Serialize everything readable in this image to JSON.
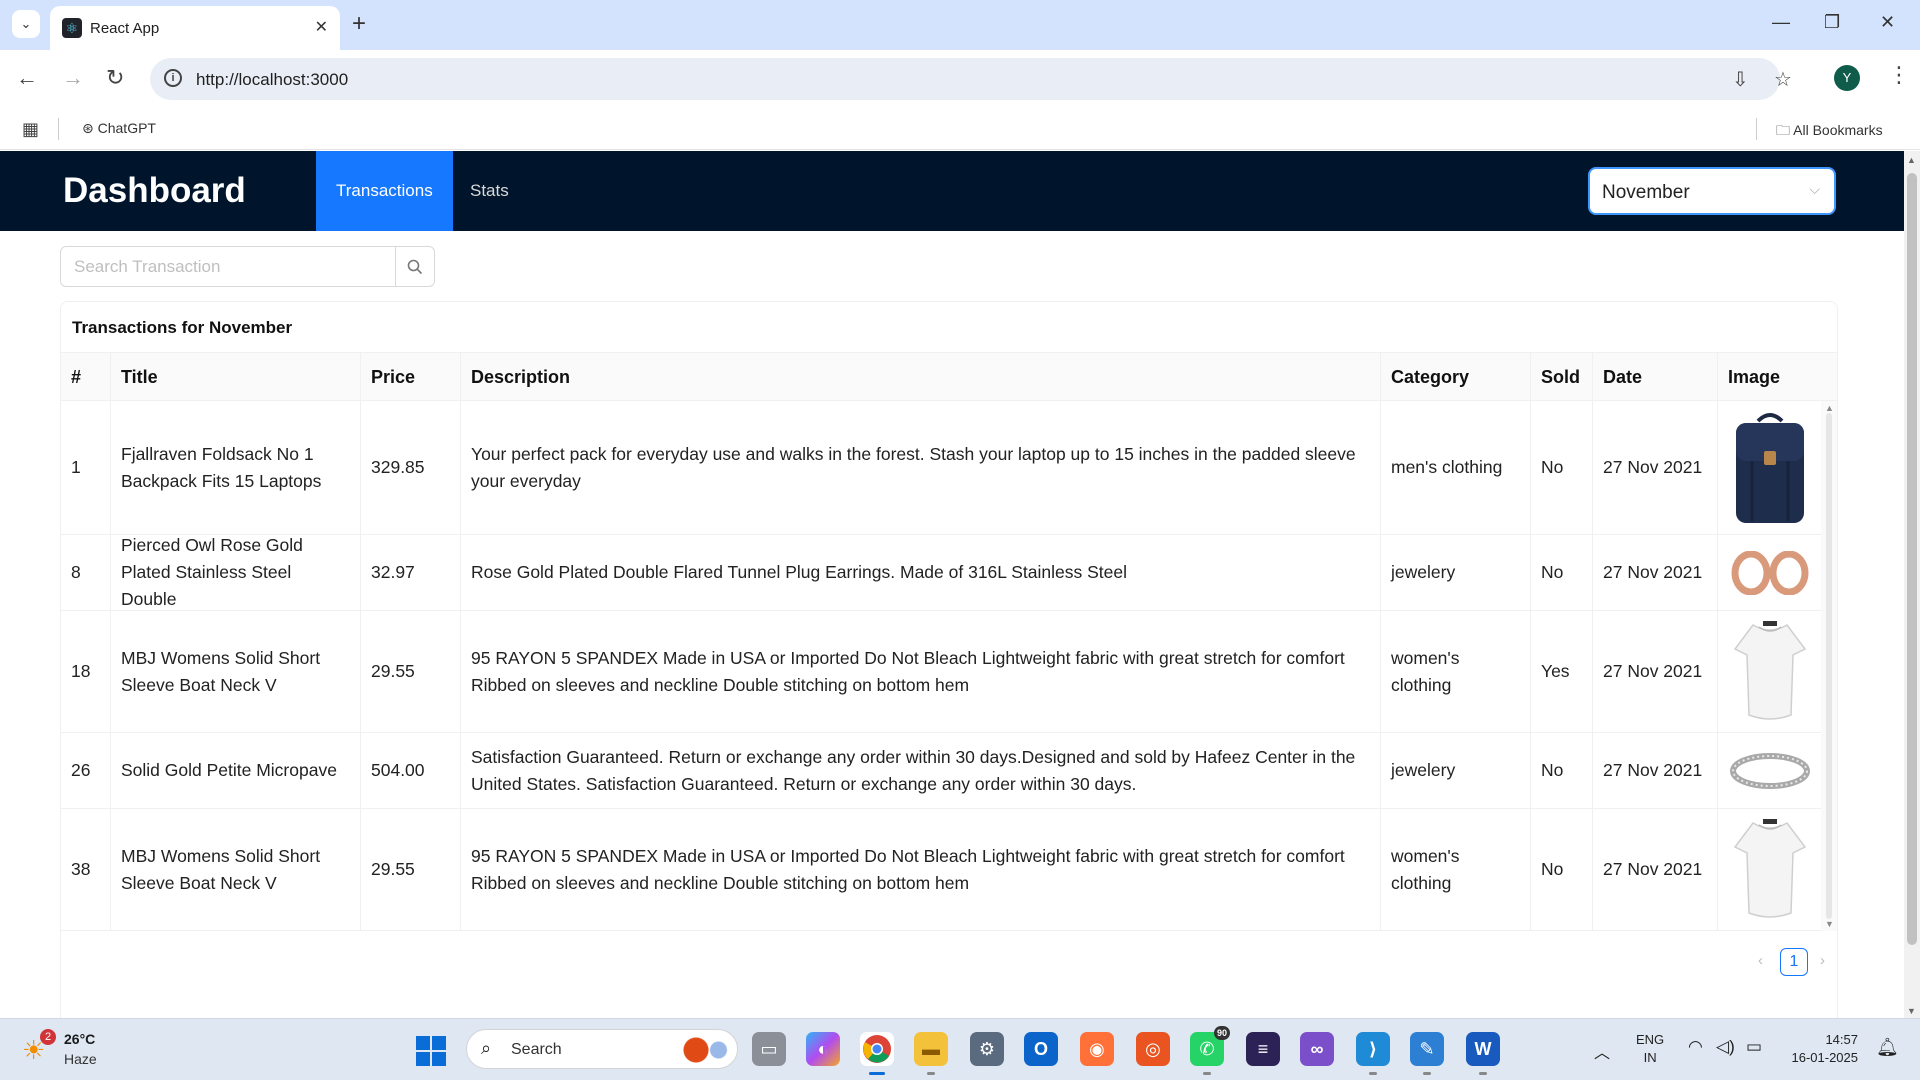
{
  "browser": {
    "tab_title": "React App",
    "url": "http://localhost:3000",
    "profile_initial": "Y",
    "bookmarks": [
      {
        "label": "ChatGPT"
      },
      {
        "label": "All Bookmarks"
      }
    ]
  },
  "app": {
    "brand": "Dashboard",
    "menu": [
      {
        "label": "Transactions",
        "active": true
      },
      {
        "label": "Stats",
        "active": false
      }
    ],
    "month_select": {
      "value": "November"
    },
    "search": {
      "placeholder": "Search Transaction",
      "value": ""
    },
    "table": {
      "title": "Transactions for November",
      "columns": [
        "#",
        "Title",
        "Price",
        "Description",
        "Category",
        "Sold",
        "Date",
        "Image"
      ],
      "rows": [
        {
          "id": "1",
          "title": "Fjallraven Foldsack No 1 Backpack Fits 15 Laptops",
          "price": "329.85",
          "description": "Your perfect pack for everyday use and walks in the forest. Stash your laptop up to 15 inches in the padded sleeve your everyday",
          "category": "men's clothing",
          "sold": "No",
          "date": "27 Nov 2021",
          "image": "backpack"
        },
        {
          "id": "8",
          "title": "Pierced Owl Rose Gold Plated Stainless Steel Double",
          "price": "32.97",
          "description": "Rose Gold Plated Double Flared Tunnel Plug Earrings. Made of 316L Stainless Steel",
          "category": "jewelery",
          "sold": "No",
          "date": "27 Nov 2021",
          "image": "earrings"
        },
        {
          "id": "18",
          "title": "MBJ Womens Solid Short Sleeve Boat Neck V",
          "price": "29.55",
          "description": "95 RAYON 5 SPANDEX Made in USA or Imported Do Not Bleach Lightweight fabric with great stretch for comfort Ribbed on sleeves and neckline Double stitching on bottom hem",
          "category": "women's clothing",
          "sold": "Yes",
          "date": "27 Nov 2021",
          "image": "white-top"
        },
        {
          "id": "26",
          "title": "Solid Gold Petite Micropave",
          "price": "504.00",
          "description": "Satisfaction Guaranteed. Return or exchange any order within 30 days.Designed and sold by Hafeez Center in the United States. Satisfaction Guaranteed. Return or exchange any order within 30 days.",
          "category": "jewelery",
          "sold": "No",
          "date": "27 Nov 2021",
          "image": "ring"
        },
        {
          "id": "38",
          "title": "MBJ Womens Solid Short Sleeve Boat Neck V",
          "price": "29.55",
          "description": "95 RAYON 5 SPANDEX Made in USA or Imported Do Not Bleach Lightweight fabric with great stretch for comfort Ribbed on sleeves and neckline Double stitching on bottom hem",
          "category": "women's clothing",
          "sold": "No",
          "date": "27 Nov 2021",
          "image": "white-top"
        }
      ]
    },
    "pagination": {
      "current_page": "1"
    }
  },
  "taskbar": {
    "weather": {
      "temp": "26°C",
      "desc": "Haze",
      "badge": "2"
    },
    "search_label": "Search",
    "whatsapp_badge": "90",
    "lang_line1": "ENG",
    "lang_line2": "IN",
    "time": "14:57",
    "date": "16-01-2025"
  },
  "colors": {
    "header_bg": "#00152b",
    "accent": "#1677ff",
    "tabstrip": "#d3e3fd",
    "taskbar": "#dfe7f2"
  }
}
